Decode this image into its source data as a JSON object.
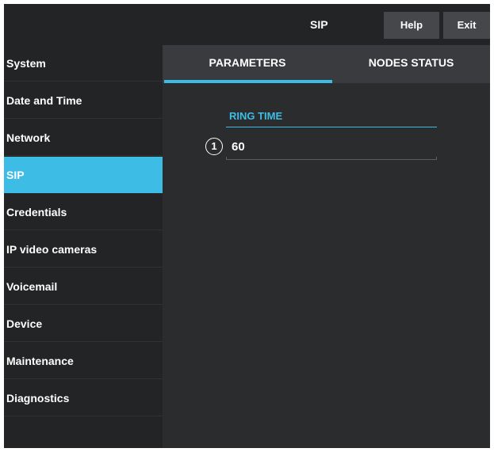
{
  "header": {
    "title": "SIP",
    "help_label": "Help",
    "exit_label": "Exit"
  },
  "sidebar": {
    "items": [
      {
        "label": "System"
      },
      {
        "label": "Date and Time"
      },
      {
        "label": "Network"
      },
      {
        "label": "SIP",
        "active": true
      },
      {
        "label": "Credentials"
      },
      {
        "label": "IP video cameras"
      },
      {
        "label": "Voicemail"
      },
      {
        "label": "Device"
      },
      {
        "label": "Maintenance"
      },
      {
        "label": "Diagnostics"
      }
    ]
  },
  "tabs": [
    {
      "label": "PARAMETERS",
      "active": true
    },
    {
      "label": "NODES STATUS"
    }
  ],
  "form": {
    "ring_time_label": "RING TIME",
    "ring_time_value": "60",
    "callout_number": "1"
  },
  "colors": {
    "accent": "#3dbde6",
    "background": "#2b2c2e",
    "sidebar": "#232425"
  }
}
